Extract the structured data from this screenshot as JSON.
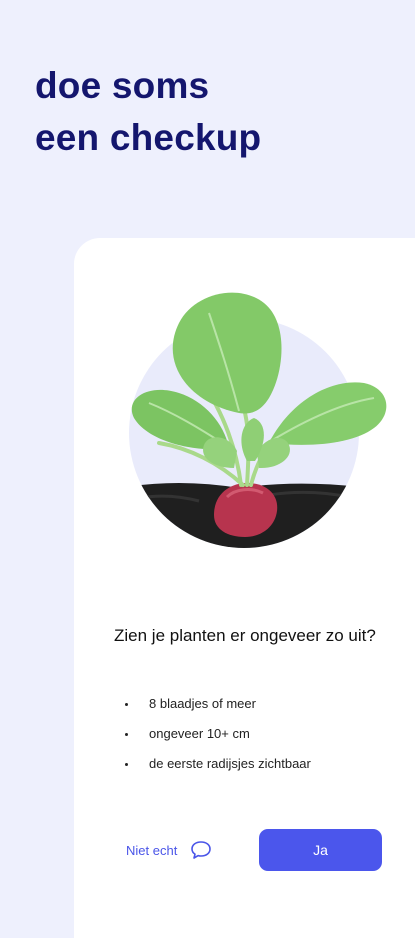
{
  "header": {
    "line1": "doe soms",
    "line2": "een checkup"
  },
  "card": {
    "question": "Zien je planten er ongeveer zo uit?",
    "checklist": [
      "8 blaadjes of meer",
      "ongeveer 10+ cm",
      "de eerste radijsjes zichtbaar"
    ],
    "secondary_button": "Niet echt",
    "primary_button": "Ja"
  },
  "icons": {
    "secondary_button_icon": "chat-bubble-icon"
  },
  "colors": {
    "background": "#eef0fd",
    "headline": "#14166e",
    "accent": "#4b56ec",
    "card": "#ffffff"
  }
}
